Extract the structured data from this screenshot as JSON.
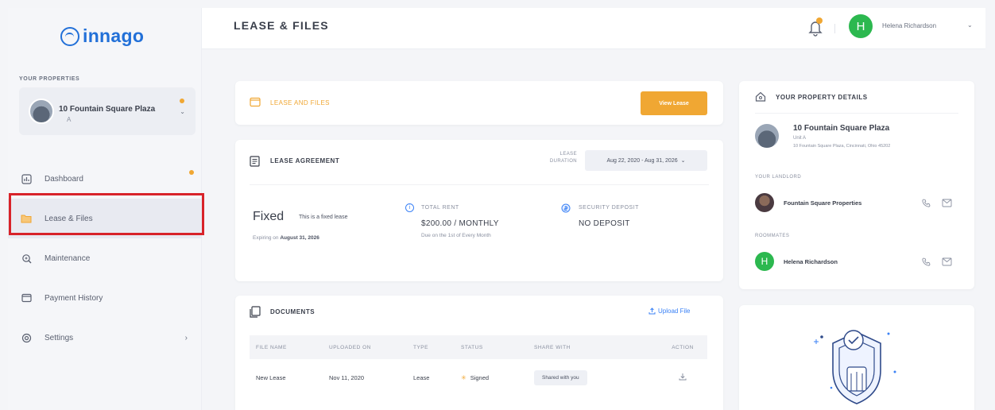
{
  "app": {
    "logo_text": "innago"
  },
  "sidebar": {
    "properties_label": "YOUR PROPERTIES",
    "property": {
      "name": "10 Fountain Square Plaza",
      "unit": "A"
    },
    "items": [
      {
        "label": "Dashboard",
        "icon": "dashboard-icon"
      },
      {
        "label": "Lease & Files",
        "icon": "folder-icon",
        "active": true
      },
      {
        "label": "Maintenance",
        "icon": "maintenance-icon"
      },
      {
        "label": "Payment History",
        "icon": "payment-icon"
      },
      {
        "label": "Settings",
        "icon": "settings-icon"
      }
    ]
  },
  "header": {
    "title": "LEASE & FILES",
    "user_initial": "H",
    "user_name": "Helena Richardson"
  },
  "lease_files": {
    "label": "LEASE AND FILES",
    "view_button": "View Lease"
  },
  "lease_agreement": {
    "title": "LEASE AGREEMENT",
    "duration_label": "LEASE DURATION",
    "duration_value": "Aug 22, 2020 - Aug 31, 2026",
    "type": "Fixed",
    "type_desc": "This is a fixed lease",
    "expiring_prefix": "Expiring on",
    "expiring_date": "August 31, 2026",
    "total_rent_label": "TOTAL RENT",
    "total_rent_value": "$200.00 / MONTHLY",
    "total_rent_sub": "Due on the 1st of Every Month",
    "deposit_label": "SECURITY DEPOSIT",
    "deposit_value": "NO DEPOSIT"
  },
  "documents": {
    "title": "DOCUMENTS",
    "upload_label": "Upload File",
    "columns": [
      "FILE NAME",
      "UPLOADED ON",
      "TYPE",
      "STATUS",
      "SHARE WITH",
      "ACTION"
    ],
    "rows": [
      {
        "file_name": "New Lease",
        "uploaded_on": "Nov 11, 2020",
        "type": "Lease",
        "status": "Signed",
        "share_with": "Shared with you"
      }
    ]
  },
  "property_details": {
    "title": "YOUR PROPERTY DETAILS",
    "name": "10 Fountain Square Plaza",
    "unit": "Unit A",
    "address": "10 Fountain Square Plaza, Cincinnati, Ohio 45202",
    "landlord_label": "YOUR LANDLORD",
    "landlord_name": "Fountain Square Properties",
    "roommates_label": "ROOMMATES",
    "roommate_initial": "H",
    "roommate_name": "Helena Richardson"
  },
  "colors": {
    "brand": "#2270d8",
    "accent": "#f0a733",
    "avatar_green": "#2cb84f",
    "highlight": "#d8232a"
  }
}
